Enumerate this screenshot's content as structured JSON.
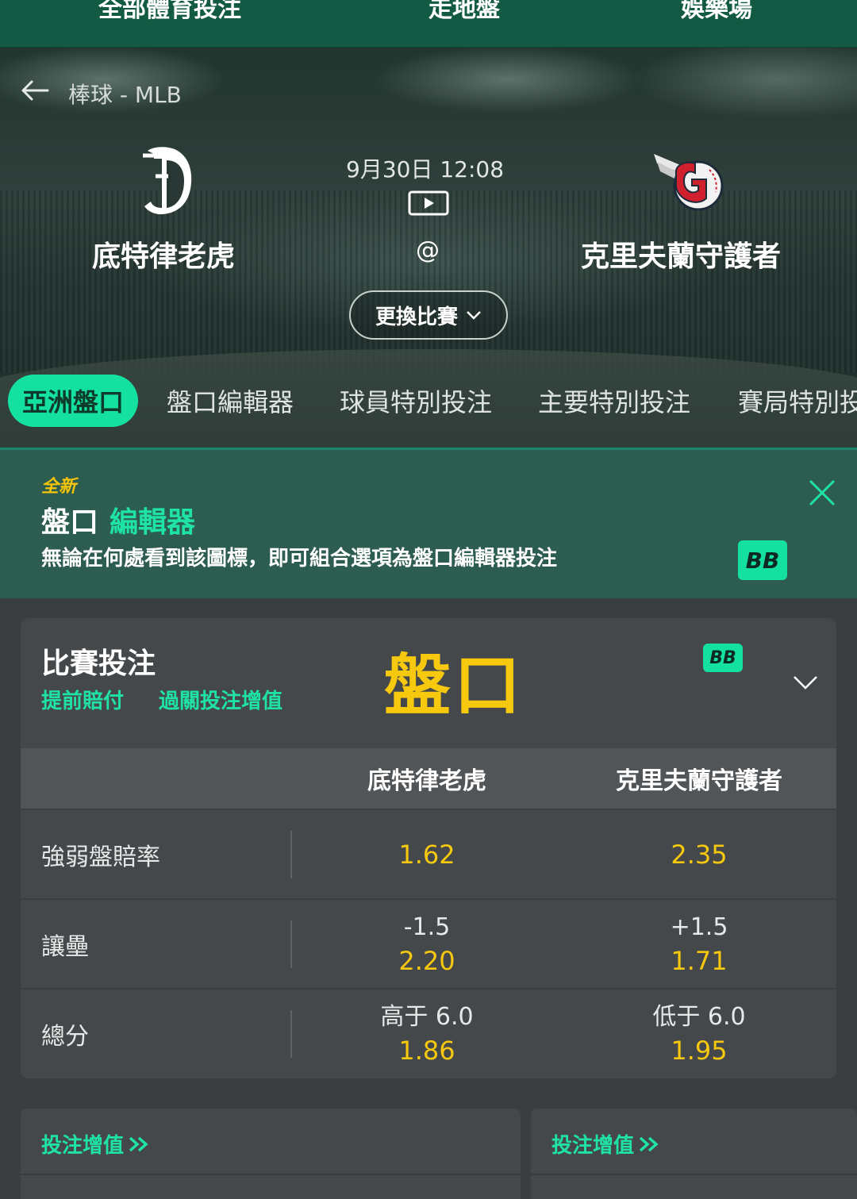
{
  "topnav": {
    "items": [
      "全部體育投注",
      "走地盤",
      "娛樂場"
    ]
  },
  "hero": {
    "breadcrumb": "棒球 - MLB",
    "home_team": "底特律老虎",
    "away_team": "克里夫蘭守護者",
    "match_time": "9月30日 12:08",
    "at": "@",
    "change_match": "更換比賽"
  },
  "tabs": [
    "亞洲盤口",
    "盤口編輯器",
    "球員特別投注",
    "主要特別投注",
    "賽局特別投"
  ],
  "promo": {
    "new_label": "全新",
    "title_part1": "盤口",
    "title_part2": "編輯器",
    "description": "無論在何處看到該圖標，即可組合選項為盤口編輯器投注",
    "badge": "BB"
  },
  "market": {
    "title": "比賽投注",
    "link1": "提前賠付",
    "link2": "過關投注增值",
    "big_label": "盤口",
    "badge": "BB",
    "columns": [
      "底特律老虎",
      "克里夫蘭守護者"
    ],
    "rows": [
      {
        "label": "強弱盤賠率",
        "home_line": "",
        "home_odds": "1.62",
        "away_line": "",
        "away_odds": "2.35"
      },
      {
        "label": "讓壘",
        "home_line": "-1.5",
        "home_odds": "2.20",
        "away_line": "+1.5",
        "away_odds": "1.71"
      },
      {
        "label": "總分",
        "home_line": "高于 6.0",
        "home_odds": "1.86",
        "away_line": "低于 6.0",
        "away_odds": "1.95"
      }
    ]
  },
  "bottom_cards": [
    {
      "label": "投注增值"
    },
    {
      "label": "投注增值"
    }
  ],
  "colors": {
    "accent": "#14e1a0",
    "odds": "#f6c80e",
    "nav": "#125a43"
  }
}
